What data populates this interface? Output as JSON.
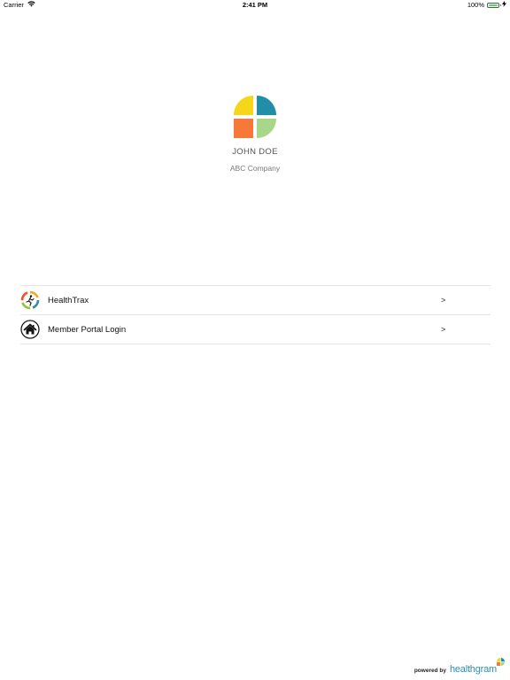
{
  "status_bar": {
    "carrier": "Carrier",
    "time": "2:41 PM",
    "battery_percent": "100%",
    "battery_level": 1.0
  },
  "profile": {
    "name": "JOHN DOE",
    "company": "ABC Company"
  },
  "menu": [
    {
      "label": "HealthTrax",
      "icon": "healthtrax-icon",
      "chevron": ">"
    },
    {
      "label": "Member Portal Login",
      "icon": "home-icon",
      "chevron": ">"
    }
  ],
  "footer": {
    "powered_by": "powered by",
    "brand": "healthgram"
  },
  "colors": {
    "logo_yellow": "#f5d619",
    "logo_teal": "#1f8ea6",
    "logo_orange": "#f7793a",
    "logo_green": "#a8d78a",
    "brand_blue": "#2a8fb3",
    "battery_green": "#4cd964"
  }
}
